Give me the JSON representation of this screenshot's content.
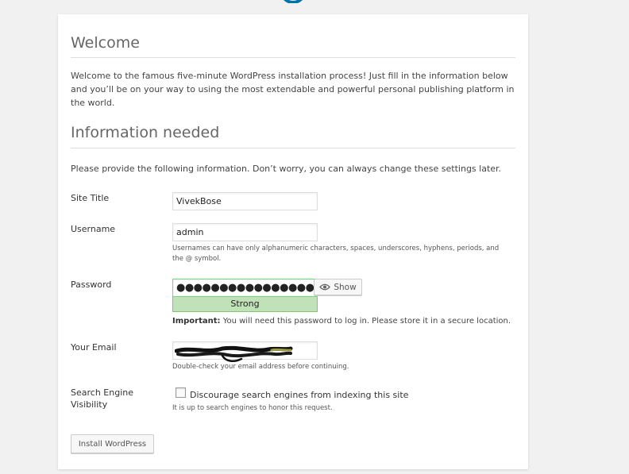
{
  "welcome": {
    "heading": "Welcome",
    "intro": "Welcome to the famous five-minute WordPress installation process! Just fill in the information below and you’ll be on your way to using the most extendable and powerful personal publishing platform in the world."
  },
  "info": {
    "heading": "Information needed",
    "intro": "Please provide the following information. Don’t worry, you can always change these settings later."
  },
  "form": {
    "site_title": {
      "label": "Site Title",
      "value": "VivekBose"
    },
    "username": {
      "label": "Username",
      "value": "admin",
      "description": "Usernames can have only alphanumeric characters, spaces, underscores, hyphens, periods, and the @ symbol."
    },
    "password": {
      "label": "Password",
      "value": "●●●●●●●●●●●●●●●●●●",
      "show_label": "Show",
      "strength": "Strong",
      "important_label": "Important:",
      "important_text": " You will need this password to log in. Please store it in a secure location."
    },
    "email": {
      "label": "Your Email",
      "description": "Double-check your email address before continuing."
    },
    "visibility": {
      "label": "Search Engine Visibility",
      "checkbox_label": "Discourage search engines from indexing this site",
      "checked": false,
      "description": "It is up to search engines to honor this request."
    },
    "submit_label": "Install WordPress"
  },
  "colors": {
    "brand": "#0073aa",
    "strength_bg": "#c1e1b9",
    "strength_border": "#83c373"
  },
  "icons": {
    "show": "eye-icon",
    "logo": "wordpress-logo"
  }
}
